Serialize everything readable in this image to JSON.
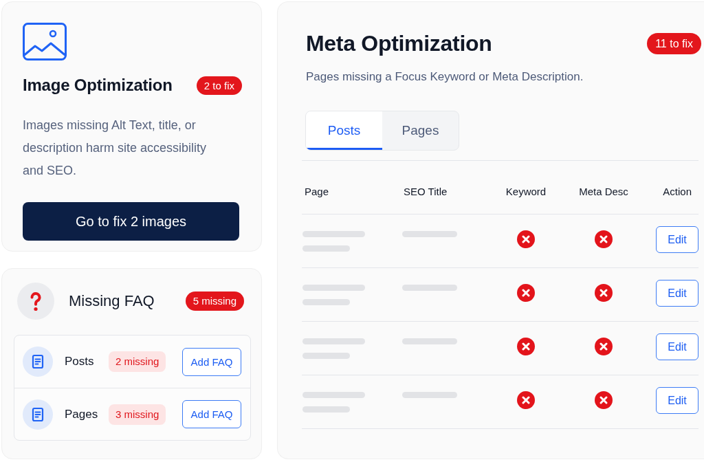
{
  "image_optimization": {
    "title": "Image Optimization",
    "badge": "2 to fix",
    "description": "Images missing Alt Text, title, or description harm site accessibility and SEO.",
    "button": "Go to fix 2 images"
  },
  "missing_faq": {
    "title": "Missing FAQ",
    "badge": "5 missing",
    "items": [
      {
        "label": "Posts",
        "badge": "2 missing",
        "button": "Add FAQ"
      },
      {
        "label": "Pages",
        "badge": "3 missing",
        "button": "Add FAQ"
      }
    ]
  },
  "meta_optimization": {
    "title": "Meta Optimization",
    "badge": "11 to fix",
    "subtitle": "Pages missing a Focus Keyword or Meta Description.",
    "tabs": [
      {
        "label": "Posts",
        "selected": true
      },
      {
        "label": "Pages",
        "selected": false
      }
    ],
    "table": {
      "columns": [
        "Page",
        "SEO Title",
        "Keyword",
        "Meta Desc",
        "Action"
      ],
      "rows": [
        {
          "keyword_missing": true,
          "meta_desc_missing": true,
          "action": "Edit"
        },
        {
          "keyword_missing": true,
          "meta_desc_missing": true,
          "action": "Edit"
        },
        {
          "keyword_missing": true,
          "meta_desc_missing": true,
          "action": "Edit"
        },
        {
          "keyword_missing": true,
          "meta_desc_missing": true,
          "action": "Edit"
        }
      ]
    }
  }
}
